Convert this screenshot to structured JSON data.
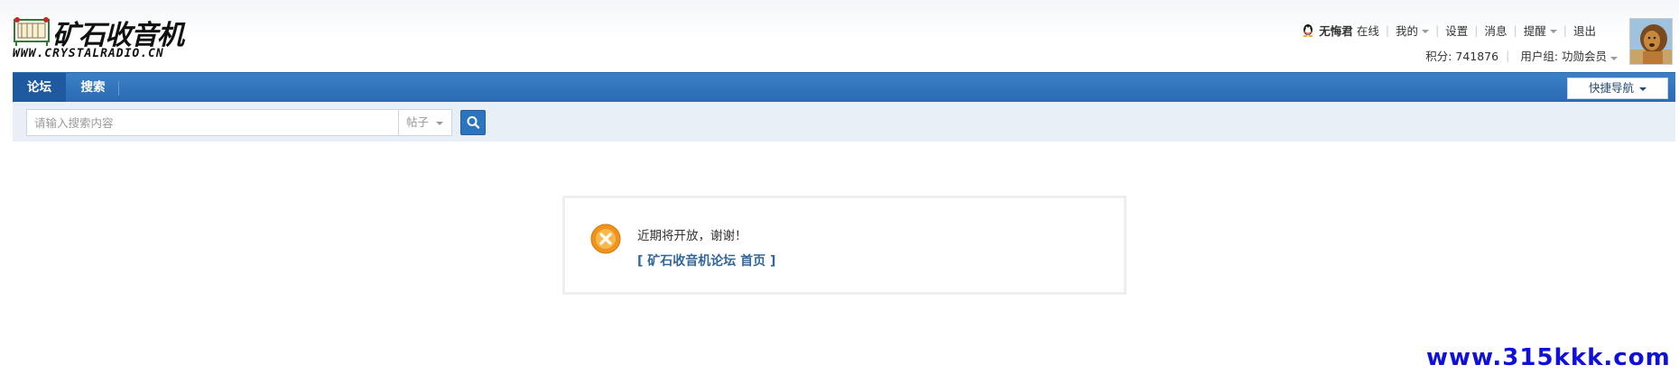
{
  "logo": {
    "title": "矿石收音机",
    "url": "WWW.CRYSTALRADIO.CN"
  },
  "user": {
    "qq_icon": "qq-penguin-icon",
    "name": "无悔君",
    "status": "在线",
    "mine": "我的",
    "settings": "设置",
    "messages": "消息",
    "remind": "提醒",
    "logout": "退出",
    "points_label": "积分: 741876",
    "usergroup_label": "用户组: 功勋会员"
  },
  "nav": {
    "forum": "论坛",
    "search": "搜索",
    "quick_nav": "快捷导航"
  },
  "search": {
    "placeholder": "请输入搜索内容",
    "type": "帖子",
    "button_icon": "search-icon"
  },
  "message": {
    "icon": "error-x-icon",
    "text": "近期将开放，谢谢！",
    "link": "[ 矿石收音机论坛 首页 ]"
  },
  "watermark": "www.315kkk.com",
  "colors": {
    "nav_blue": "#2a6bb3",
    "nav_active": "#1f5aa0",
    "link_blue": "#336699",
    "error_orange": "#f0931c",
    "watermark_blue": "#1010dd"
  }
}
